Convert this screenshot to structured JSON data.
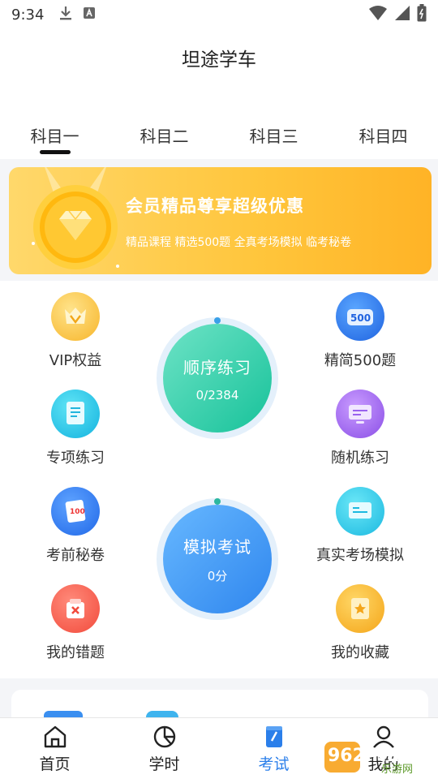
{
  "status_bar": {
    "time": "9:34",
    "icons": [
      "download-icon",
      "text-app-icon",
      "wifi-icon",
      "signal-icon",
      "battery-icon"
    ]
  },
  "header": {
    "title": "坦途学车",
    "tabs": [
      {
        "label": "科目一",
        "active": true
      },
      {
        "label": "科目二",
        "active": false
      },
      {
        "label": "科目三",
        "active": false
      },
      {
        "label": "科目四",
        "active": false
      }
    ]
  },
  "promo": {
    "title": "会员精品尊享超级优惠",
    "subtitle": "精品课程  精选500题  全真考场模拟  临考秘卷",
    "icon": "diamond-medal-icon",
    "colors": {
      "start": "#ffd86b",
      "end": "#ffb326"
    }
  },
  "features": {
    "vip": {
      "label": "VIP权益",
      "icon": "vip-crown-icon"
    },
    "selected500": {
      "label": "精简500题",
      "icon": "500-badge-icon",
      "badge": "500"
    },
    "special": {
      "label": "专项练习",
      "icon": "document-icon"
    },
    "random": {
      "label": "随机练习",
      "icon": "monitor-icon"
    },
    "secret": {
      "label": "考前秘卷",
      "icon": "exam-paper-icon",
      "badge": "100"
    },
    "realexam": {
      "label": "真实考场模拟",
      "icon": "screen-icon"
    },
    "mistakes": {
      "label": "我的错题",
      "icon": "wrong-box-icon"
    },
    "favorites": {
      "label": "我的收藏",
      "icon": "star-bookmark-icon"
    }
  },
  "practice": {
    "sequential": {
      "title": "顺序练习",
      "progress": "0/2384",
      "color": "#29c9a0"
    },
    "mock": {
      "title": "模拟考试",
      "score": "0分",
      "color": "#3a8ff0"
    }
  },
  "bottom_nav": [
    {
      "label": "首页",
      "icon": "home-icon",
      "active": false
    },
    {
      "label": "学时",
      "icon": "pie-chart-icon",
      "active": false
    },
    {
      "label": "考试",
      "icon": "exam-book-icon",
      "active": true
    },
    {
      "label": "我的",
      "icon": "user-icon",
      "active": false
    }
  ],
  "watermark": {
    "text": "962.NET",
    "subtext": "乐游网"
  }
}
